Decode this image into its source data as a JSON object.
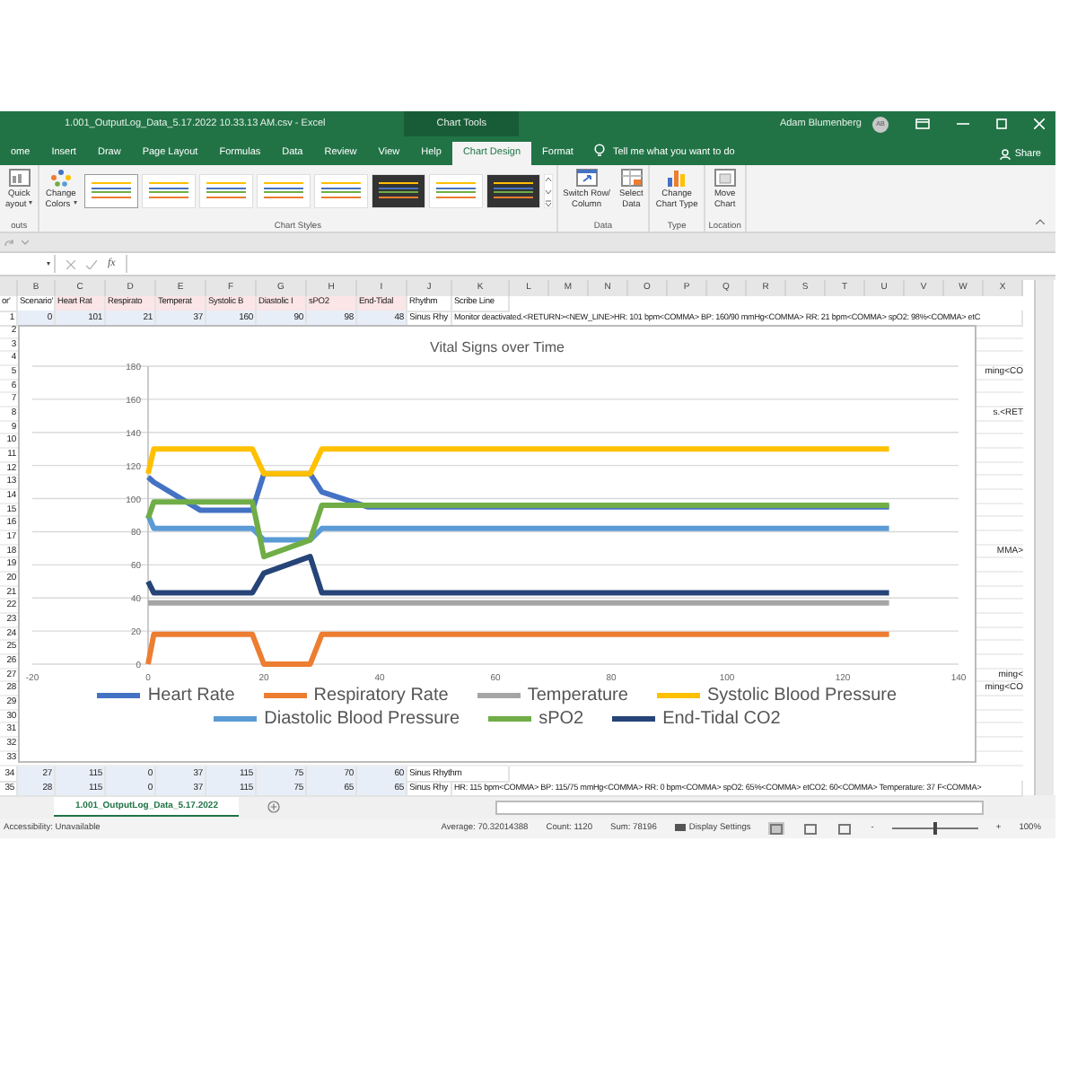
{
  "window": {
    "title": "1.001_OutputLog_Data_5.17.2022 10.33.13 AM.csv  -  Excel",
    "context_title": "Chart Tools",
    "user": "Adam Blumenberg",
    "avatar": "AB"
  },
  "tabs": [
    {
      "label": "ome",
      "selected": false
    },
    {
      "label": "Insert",
      "selected": false
    },
    {
      "label": "Draw",
      "selected": false
    },
    {
      "label": "Page Layout",
      "selected": false
    },
    {
      "label": "Formulas",
      "selected": false
    },
    {
      "label": "Data",
      "selected": false
    },
    {
      "label": "Review",
      "selected": false
    },
    {
      "label": "View",
      "selected": false
    },
    {
      "label": "Help",
      "selected": false
    },
    {
      "label": "Chart Design",
      "selected": true
    },
    {
      "label": "Format",
      "selected": false
    }
  ],
  "tell_me": {
    "placeholder": "Tell me what you want to do"
  },
  "share": "Share",
  "ribbon": [
    {
      "label": "outs",
      "items": [
        {
          "kind": "button",
          "lines": [
            "Quick",
            "ayout"
          ],
          "dropdown": true
        }
      ]
    },
    {
      "label": "Chart Styles",
      "items": [
        {
          "kind": "button",
          "lines": [
            "Change",
            "Colors"
          ],
          "dropdown": true
        },
        {
          "kind": "gallery",
          "styles": [
            {
              "selected": true,
              "dark": false
            },
            {
              "selected": false,
              "dark": false
            },
            {
              "selected": false,
              "dark": false
            },
            {
              "selected": false,
              "dark": false
            },
            {
              "selected": false,
              "dark": false
            },
            {
              "selected": false,
              "dark": true
            },
            {
              "selected": false,
              "dark": false
            },
            {
              "selected": false,
              "dark": true
            }
          ]
        }
      ]
    },
    {
      "label": "Data",
      "items": [
        {
          "kind": "button",
          "lines": [
            "Switch Row/",
            "Column"
          ]
        },
        {
          "kind": "button",
          "lines": [
            "Select",
            "Data"
          ]
        }
      ]
    },
    {
      "label": "Type",
      "items": [
        {
          "kind": "button",
          "lines": [
            "Change",
            "Chart Type"
          ]
        }
      ]
    },
    {
      "label": "Location",
      "items": [
        {
          "kind": "button",
          "lines": [
            "Move",
            "Chart"
          ]
        }
      ]
    }
  ],
  "formula_bar": {
    "function_label": "fx"
  },
  "sheet": {
    "columns": [
      "B",
      "C",
      "D",
      "E",
      "F",
      "G",
      "H",
      "I",
      "J",
      "K",
      "L",
      "M",
      "N",
      "O",
      "P",
      "Q",
      "R",
      "S",
      "T",
      "U",
      "V",
      "W",
      "X"
    ],
    "header_row": [
      "or'",
      "Scenario'",
      "Heart Rat",
      "Respirato",
      "Temperat",
      "Systolic B",
      "Diastolic I",
      "sPO2",
      "End-Tidal",
      "Rhythm",
      "Scribe Line"
    ],
    "top_rows": [
      {
        "cells": [
          "1",
          "0",
          "101",
          "21",
          "37",
          "160",
          "90",
          "98",
          "48",
          "Sinus Rhy",
          "Monitor deactivated.<RETURN><NEW_LINE>HR: 101 bpm<COMMA> BP: 160/90 mmHg<COMMA> RR: 21 bpm<COMMA> spO2: 98%<COMMA> etC"
        ]
      }
    ],
    "covered_rows": [
      {
        "a": "2"
      },
      {
        "a": "3"
      },
      {
        "a": "4"
      },
      {
        "a": "5",
        "tail": "ming<CO"
      },
      {
        "a": "6"
      },
      {
        "a": "7"
      },
      {
        "a": "8",
        "tail": "s.<RET"
      },
      {
        "a": "9"
      },
      {
        "a": "10"
      },
      {
        "a": "11"
      },
      {
        "a": "12"
      },
      {
        "a": "13"
      },
      {
        "a": "14"
      },
      {
        "a": "15"
      },
      {
        "a": "16"
      },
      {
        "a": "17"
      },
      {
        "a": "18",
        "tail": "MMA>"
      },
      {
        "a": "19"
      },
      {
        "a": "20"
      },
      {
        "a": "21"
      },
      {
        "a": "22"
      },
      {
        "a": "23"
      },
      {
        "a": "24"
      },
      {
        "a": "25"
      },
      {
        "a": "26"
      },
      {
        "a": "27",
        "tail": "ming<"
      },
      {
        "a": "28",
        "tail": "ming<CO"
      },
      {
        "a": "29"
      },
      {
        "a": "30"
      },
      {
        "a": "31"
      },
      {
        "a": "32"
      },
      {
        "a": "33"
      }
    ],
    "bottom_rows": [
      {
        "cells": [
          "34",
          "27",
          "115",
          "0",
          "37",
          "115",
          "75",
          "70",
          "60",
          "Sinus Rhythm"
        ]
      },
      {
        "cells": [
          "35",
          "28",
          "115",
          "0",
          "37",
          "115",
          "75",
          "65",
          "65",
          "Sinus Rhy",
          "HR: 115 bpm<COMMA> BP: 115/75 mmHg<COMMA> RR: 0 bpm<COMMA> spO2: 65%<COMMA> etCO2: 60<COMMA> Temperature: 37 F<COMMA>"
        ]
      }
    ]
  },
  "chart": {
    "chart_data": {
      "type": "line",
      "title": "Vital Signs over Time",
      "x": [
        0,
        1,
        9,
        18,
        20,
        28,
        30,
        38,
        128
      ],
      "series": [
        {
          "name": "Heart Rate",
          "color": "#4472c4",
          "values": [
            113,
            110,
            93,
            93,
            115,
            115,
            104,
            95,
            95
          ]
        },
        {
          "name": "Respiratory Rate",
          "color": "#ed7d31",
          "values": [
            0,
            18,
            18,
            18,
            0,
            0,
            18,
            18,
            18
          ]
        },
        {
          "name": "Temperature",
          "color": "#a5a5a5",
          "values": [
            37,
            37,
            37,
            37,
            37,
            37,
            37,
            37,
            37
          ]
        },
        {
          "name": "Systolic Blood Pressure",
          "color": "#ffc000",
          "values": [
            115,
            130,
            130,
            130,
            115,
            115,
            130,
            130,
            130
          ]
        },
        {
          "name": "Diastolic Blood Pressure",
          "color": "#5b9bd5",
          "values": [
            90,
            82,
            82,
            82,
            75,
            75,
            82,
            82,
            82
          ]
        },
        {
          "name": "sPO2",
          "color": "#70ad47",
          "values": [
            88,
            98,
            98,
            98,
            65,
            75,
            96,
            96,
            96
          ]
        },
        {
          "name": "End-Tidal CO2",
          "color": "#264478",
          "values": [
            50,
            43,
            43,
            43,
            55,
            65,
            43,
            43,
            43
          ]
        }
      ],
      "grid": true,
      "xlim": [
        -20,
        140
      ],
      "ylim": [
        0,
        180
      ],
      "xticks": [
        -20,
        0,
        20,
        40,
        60,
        80,
        100,
        120,
        140
      ],
      "yticks": [
        0,
        20,
        40,
        60,
        80,
        100,
        120,
        140,
        160,
        180
      ]
    }
  },
  "sheet_tabs": [
    {
      "name": "1.001_OutputLog_Data_5.17.2022",
      "selected": true
    }
  ],
  "status_bar": {
    "accessibility": "Accessibility: Unavailable",
    "average": "Average: 70.32014388",
    "count": "Count: 1120",
    "sum": "Sum: 78196",
    "display_settings": "Display Settings",
    "views": [
      {
        "selected": true
      },
      {
        "selected": false
      },
      {
        "selected": false
      }
    ],
    "zoom": {
      "minus": "-",
      "plus": "+",
      "level": 0.5,
      "label": "100%"
    }
  }
}
